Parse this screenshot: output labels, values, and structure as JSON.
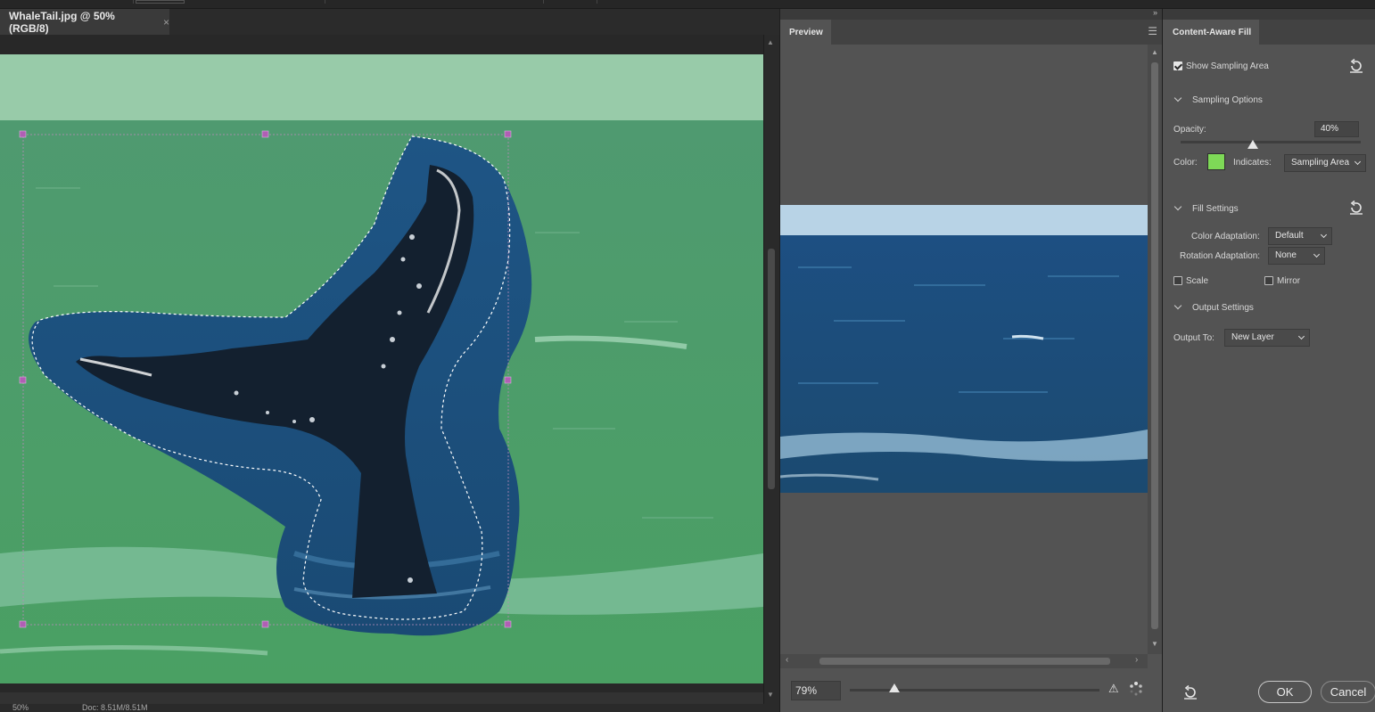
{
  "document": {
    "tab_title": "WhaleTail.jpg @ 50% (RGB/8)",
    "tab_close": "×",
    "status_zoom": "50%",
    "status_doc": "Doc: 8.51M/8.51M"
  },
  "preview": {
    "tab_label": "Preview",
    "zoom_value": "79%",
    "zoom_slider_fraction": 0.18
  },
  "content_aware_fill": {
    "tab_label": "Content-Aware Fill",
    "show_sampling_area": {
      "label": "Show Sampling Area",
      "checked": true
    },
    "sampling_options": {
      "header": "Sampling Options",
      "opacity_label": "Opacity:",
      "opacity_value": "40%",
      "color_label": "Color:",
      "color_value": "#7ed957",
      "indicates_label": "Indicates:",
      "indicates_value": "Sampling Area"
    },
    "fill_settings": {
      "header": "Fill Settings",
      "color_adaptation_label": "Color Adaptation:",
      "color_adaptation_value": "Default",
      "rotation_adaptation_label": "Rotation Adaptation:",
      "rotation_adaptation_value": "None",
      "scale_label": "Scale",
      "scale_checked": false,
      "mirror_label": "Mirror",
      "mirror_checked": false
    },
    "output_settings": {
      "header": "Output Settings",
      "output_to_label": "Output To:",
      "output_to_value": "New Layer"
    },
    "buttons": {
      "ok": "OK",
      "cancel": "Cancel"
    }
  },
  "colors": {
    "panel_bg": "#535353",
    "sampling_overlay": "#7ed957",
    "ocean_blue": "#1d4f7a"
  }
}
